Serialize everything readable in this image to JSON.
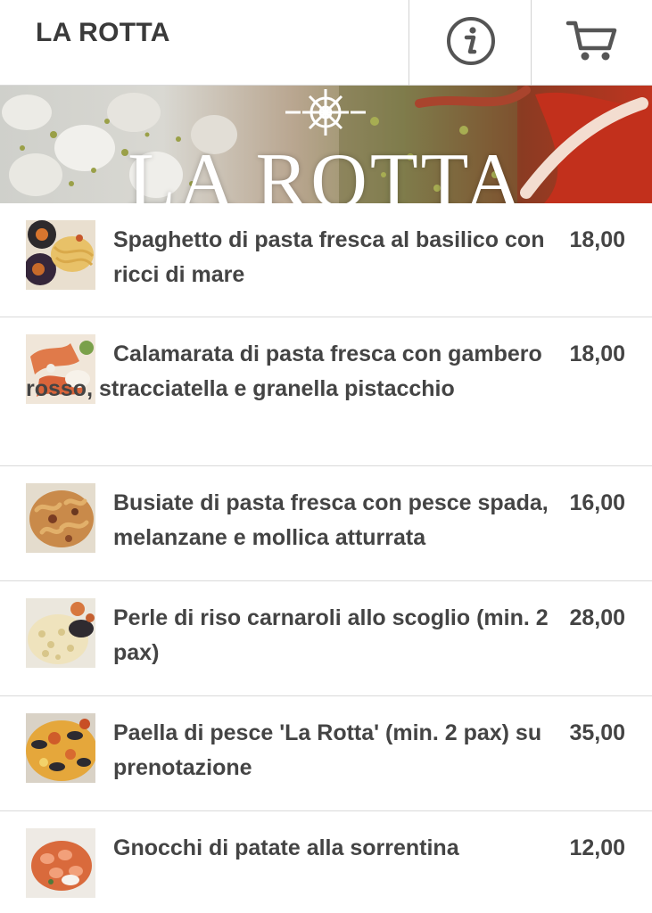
{
  "header": {
    "title": "LA ROTTA",
    "info_icon": "info-icon",
    "cart_icon": "cart-icon"
  },
  "banner": {
    "title": "LA ROTTA",
    "emblem_icon": "ship-wheel-icon"
  },
  "menu": {
    "items": [
      {
        "name": "Spaghetto di pasta fresca al basilico con ricci di mare",
        "price": "18,00",
        "thumb": "sea-urchin-spaghetti"
      },
      {
        "name": "Calamarata di pasta fresca con gambero rosso, stracciatella e granella pistacchio",
        "price": "18,00",
        "thumb": "calamarata-shrimp"
      },
      {
        "name": "Busiate di pasta fresca con pesce spada, melanzane e mollica atturrata",
        "price": "16,00",
        "thumb": "busiate-swordfish"
      },
      {
        "name": "Perle di riso carnaroli allo scoglio (min. 2 pax)",
        "price": "28,00",
        "thumb": "seafood-risotto"
      },
      {
        "name": "Paella di pesce 'La Rotta' (min. 2 pax) su prenotazione",
        "price": "35,00",
        "thumb": "seafood-paella"
      },
      {
        "name": "Gnocchi di patate alla sorrentina",
        "price": "12,00",
        "thumb": "gnocchi-sorrentina"
      }
    ]
  },
  "colors": {
    "text": "#3a3a3a",
    "divider": "#d9d9d9",
    "icon": "#555555"
  }
}
